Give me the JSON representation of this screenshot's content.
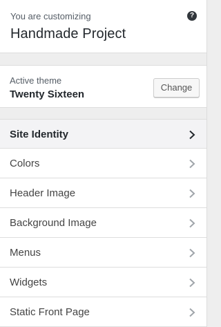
{
  "info": {
    "caption": "You are customizing",
    "site_title": "Handmade Project",
    "help_icon": "help-icon",
    "help_glyph": "?"
  },
  "theme": {
    "caption": "Active theme",
    "name": "Twenty Sixteen",
    "change_label": "Change"
  },
  "sections": [
    {
      "label": "Site Identity",
      "icon": "chevron-right-icon",
      "active": true
    },
    {
      "label": "Colors",
      "icon": "chevron-right-icon"
    },
    {
      "label": "Header Image",
      "icon": "chevron-right-icon"
    },
    {
      "label": "Background Image",
      "icon": "chevron-right-icon"
    },
    {
      "label": "Menus",
      "icon": "chevron-right-icon"
    },
    {
      "label": "Widgets",
      "icon": "chevron-right-icon"
    },
    {
      "label": "Static Front Page",
      "icon": "chevron-right-icon"
    }
  ],
  "colors": {
    "chevron_active": "#23282d",
    "chevron": "#a0a5aa"
  }
}
